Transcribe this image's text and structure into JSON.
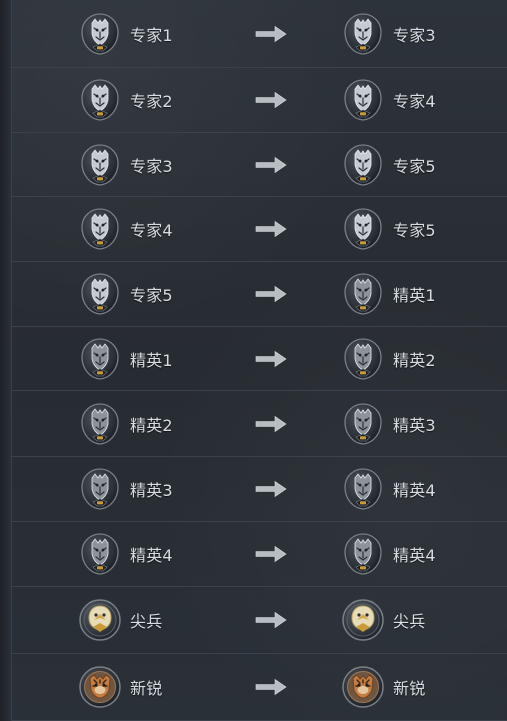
{
  "rows": [
    {
      "from": {
        "label": "专家1",
        "badge": "wolf-expert-badge-icon",
        "numeral": "I"
      },
      "to": {
        "label": "专家3",
        "badge": "wolf-expert-badge-icon",
        "numeral": "III"
      },
      "arrow": "right-arrow-icon"
    },
    {
      "from": {
        "label": "专家2",
        "badge": "wolf-expert-badge-icon",
        "numeral": "II"
      },
      "to": {
        "label": "专家4",
        "badge": "wolf-expert-badge-icon",
        "numeral": "IV"
      },
      "arrow": "right-arrow-icon"
    },
    {
      "from": {
        "label": "专家3",
        "badge": "wolf-expert-badge-icon",
        "numeral": "III"
      },
      "to": {
        "label": "专家5",
        "badge": "wolf-expert-badge-icon",
        "numeral": "V"
      },
      "arrow": "right-arrow-icon"
    },
    {
      "from": {
        "label": "专家4",
        "badge": "wolf-expert-badge-icon",
        "numeral": "IV"
      },
      "to": {
        "label": "专家5",
        "badge": "wolf-expert-badge-icon",
        "numeral": "V"
      },
      "arrow": "right-arrow-icon"
    },
    {
      "from": {
        "label": "专家5",
        "badge": "wolf-expert-badge-icon",
        "numeral": "V"
      },
      "to": {
        "label": "精英1",
        "badge": "wolf-elite-badge-icon",
        "numeral": "I"
      },
      "arrow": "right-arrow-icon"
    },
    {
      "from": {
        "label": "精英1",
        "badge": "wolf-elite-badge-icon",
        "numeral": "I"
      },
      "to": {
        "label": "精英2",
        "badge": "wolf-elite-badge-icon",
        "numeral": "II"
      },
      "arrow": "right-arrow-icon"
    },
    {
      "from": {
        "label": "精英2",
        "badge": "wolf-elite-badge-icon",
        "numeral": "II"
      },
      "to": {
        "label": "精英3",
        "badge": "wolf-elite-badge-icon",
        "numeral": "III"
      },
      "arrow": "right-arrow-icon"
    },
    {
      "from": {
        "label": "精英3",
        "badge": "wolf-elite-badge-icon",
        "numeral": "III"
      },
      "to": {
        "label": "精英4",
        "badge": "wolf-elite-badge-icon",
        "numeral": "IV"
      },
      "arrow": "right-arrow-icon"
    },
    {
      "from": {
        "label": "精英4",
        "badge": "wolf-elite-badge-icon",
        "numeral": "IV"
      },
      "to": {
        "label": "精英4",
        "badge": "wolf-elite-badge-icon",
        "numeral": "IV"
      },
      "arrow": "right-arrow-icon"
    },
    {
      "from": {
        "label": "尖兵",
        "badge": "eagle-vanguard-badge-icon",
        "numeral": ""
      },
      "to": {
        "label": "尖兵",
        "badge": "eagle-vanguard-badge-icon",
        "numeral": ""
      },
      "arrow": "right-arrow-icon"
    },
    {
      "from": {
        "label": "新锐",
        "badge": "tiger-rookie-badge-icon",
        "numeral": ""
      },
      "to": {
        "label": "新锐",
        "badge": "tiger-rookie-badge-icon",
        "numeral": ""
      },
      "arrow": "right-arrow-icon"
    }
  ],
  "colors": {
    "background": "#2a3037",
    "row_divider": "#3b424b",
    "text": "#d8dde3",
    "arrow": "#b7bcc2",
    "wolf_silver": "#c9ced4",
    "gold": "#c89a3a",
    "eagle_gold": "#d8c07a",
    "tiger_orange": "#b8763b"
  }
}
